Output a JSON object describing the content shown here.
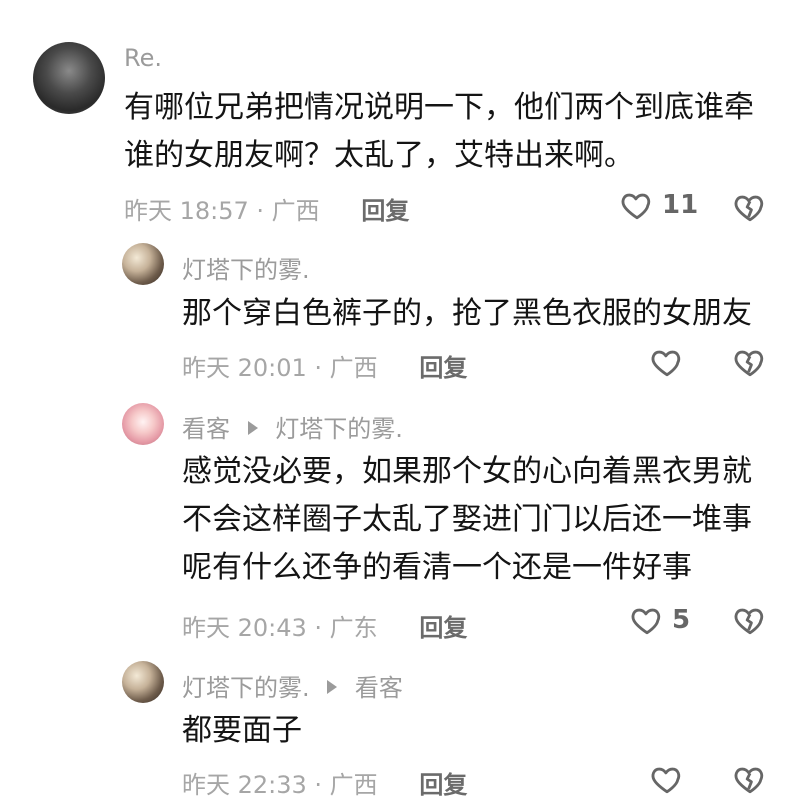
{
  "comments": [
    {
      "username": "Re.",
      "lines": [
        "有哪位兄弟把情况说明一下，他们两个到底谁牵",
        "谁的女朋友啊？太乱了，艾特出来啊。"
      ],
      "time": "昨天 18:57 · 广西",
      "reply_label": "回复",
      "likes": "11"
    },
    {
      "username": "灯塔下的雾.",
      "lines": [
        "那个穿白色裤子的，抢了黑色衣服的女朋友"
      ],
      "time": "昨天 20:01 · 广西",
      "reply_label": "回复",
      "likes": ""
    },
    {
      "username": "看客",
      "reply_to": "灯塔下的雾.",
      "lines": [
        "感觉没必要，如果那个女的心向着黑衣男就",
        "不会这样圈子太乱了娶进门门以后还一堆事",
        "呢有什么还争的看清一个还是一件好事"
      ],
      "time": "昨天 20:43 · 广东",
      "reply_label": "回复",
      "likes": "5"
    },
    {
      "username": "灯塔下的雾.",
      "reply_to": "看客",
      "lines": [
        "都要面子"
      ],
      "time": "昨天 22:33 · 广西",
      "reply_label": "回复",
      "likes": ""
    }
  ],
  "icons": {
    "like": "heart-outline-icon",
    "dislike": "broken-heart-icon"
  },
  "colors": {
    "text": "#141414",
    "muted": "#9b9b9b",
    "icon": "#666666"
  }
}
